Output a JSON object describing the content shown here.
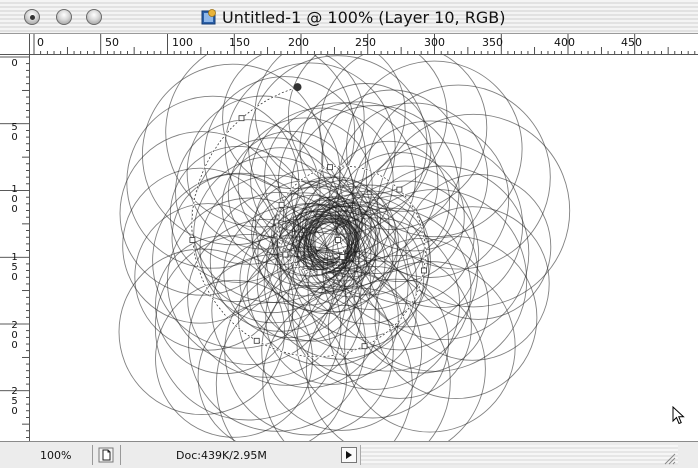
{
  "window": {
    "title": "Untitled-1 @ 100% (Layer 10, RGB)"
  },
  "rulers": {
    "horizontal_labels": [
      "0",
      "50",
      "100",
      "150",
      "200",
      "250",
      "300",
      "350",
      "400",
      "450"
    ],
    "vertical_labels": [
      "0",
      "50",
      "100",
      "150",
      "200",
      "250"
    ]
  },
  "status_bar": {
    "zoom": "100%",
    "doc_size": "Doc:439K/2.95M"
  },
  "icons": {
    "close": "close-button-icon",
    "minimize": "minimize-button-icon",
    "zoom": "zoom-button-icon",
    "document": "photoshop-document-icon",
    "cursor": "arrow-cursor-icon",
    "status_menu": "triangle-right-icon",
    "page": "page-icon"
  },
  "colors": {
    "stroke": "#1a1a1a",
    "canvas": "#ffffff",
    "path": "#ffffff"
  }
}
